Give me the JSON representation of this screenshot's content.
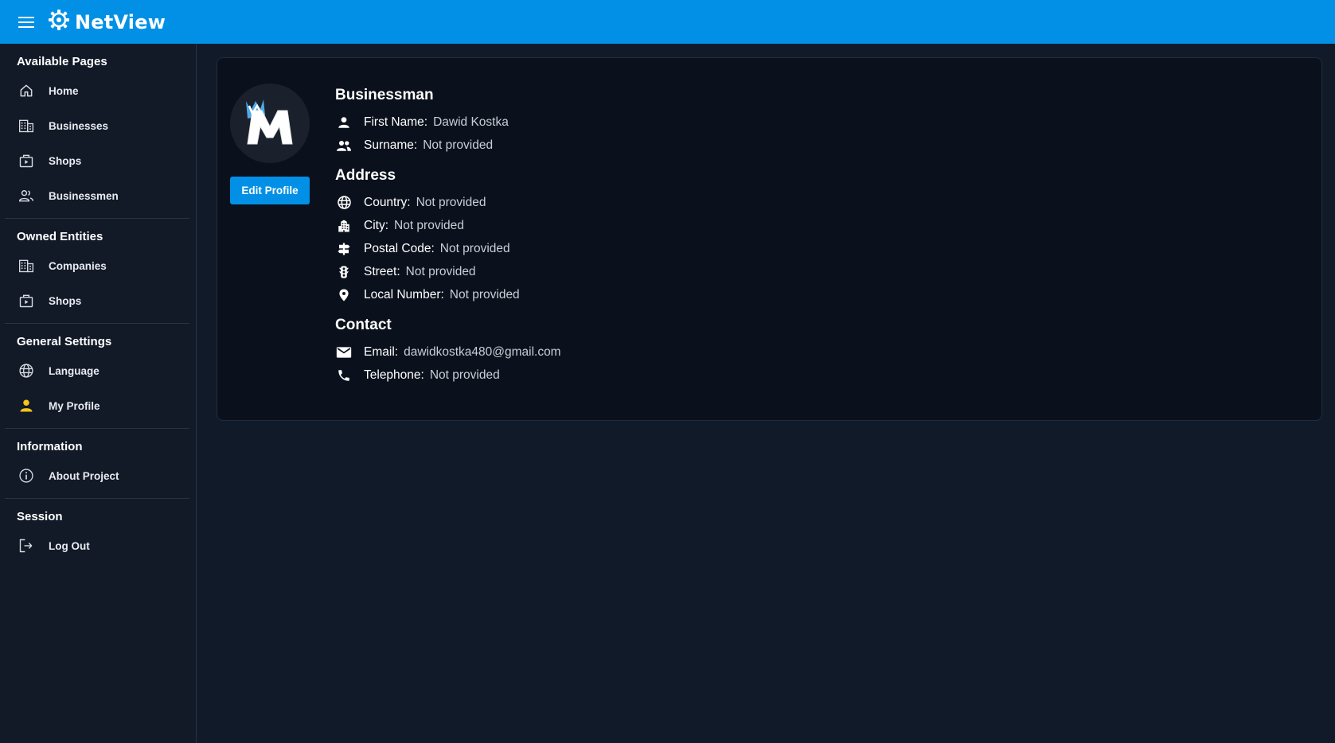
{
  "app": {
    "name": "NetView"
  },
  "sidebar": {
    "sections": [
      {
        "title": "Available Pages",
        "items": [
          {
            "label": "Home",
            "icon": "home-icon"
          },
          {
            "label": "Businesses",
            "icon": "building-icon"
          },
          {
            "label": "Shops",
            "icon": "shop-icon"
          },
          {
            "label": "Businessmen",
            "icon": "people-icon"
          }
        ]
      },
      {
        "title": "Owned Entities",
        "items": [
          {
            "label": "Companies",
            "icon": "building-icon"
          },
          {
            "label": "Shops",
            "icon": "shop-icon"
          }
        ]
      },
      {
        "title": "General Settings",
        "items": [
          {
            "label": "Language",
            "icon": "globe-icon"
          },
          {
            "label": "My Profile",
            "icon": "person-icon",
            "active_color": "#f5c518"
          }
        ]
      },
      {
        "title": "Information",
        "items": [
          {
            "label": "About Project",
            "icon": "info-icon"
          }
        ]
      },
      {
        "title": "Session",
        "items": [
          {
            "label": "Log Out",
            "icon": "logout-icon"
          }
        ]
      }
    ]
  },
  "profile": {
    "edit_label": "Edit Profile",
    "businessman": {
      "title": "Businessman",
      "first_name": {
        "label": "First Name:",
        "value": "Dawid Kostka"
      },
      "surname": {
        "label": "Surname:",
        "value": "Not provided"
      }
    },
    "address": {
      "title": "Address",
      "country": {
        "label": "Country:",
        "value": "Not provided"
      },
      "city": {
        "label": "City:",
        "value": "Not provided"
      },
      "postal_code": {
        "label": "Postal Code:",
        "value": "Not provided"
      },
      "street": {
        "label": "Street:",
        "value": "Not provided"
      },
      "local_number": {
        "label": "Local Number:",
        "value": "Not provided"
      }
    },
    "contact": {
      "title": "Contact",
      "email": {
        "label": "Email:",
        "value": "dawidkostka480@gmail.com"
      },
      "telephone": {
        "label": "Telephone:",
        "value": "Not provided"
      }
    }
  },
  "colors": {
    "accent": "#0290e6",
    "background": "#111a29",
    "card": "#0b111c",
    "highlight": "#f5c518"
  }
}
